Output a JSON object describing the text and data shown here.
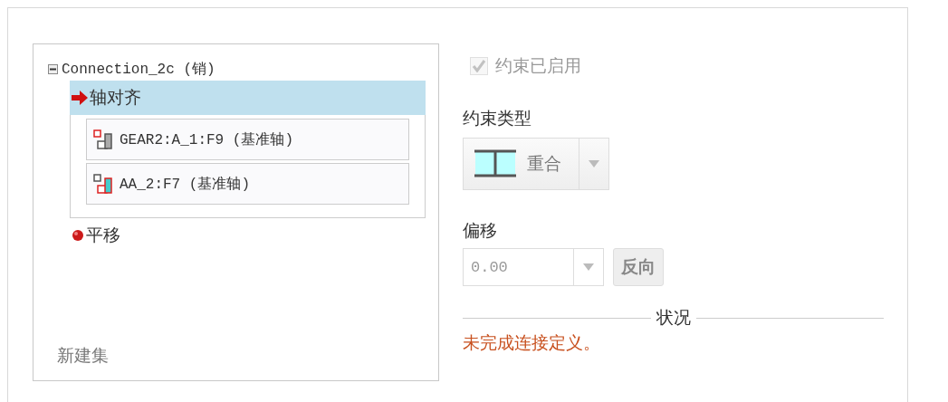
{
  "connection": {
    "name": "Connection_2c (销)",
    "expanded": true,
    "children": [
      {
        "name": "轴对齐",
        "kind": "arrow",
        "selected": true,
        "children": [
          {
            "label": "GEAR2:A_1:F9 (基准轴)",
            "kind": "first"
          },
          {
            "label": "AA_2:F7 (基准轴)",
            "kind": "second"
          }
        ]
      },
      {
        "name": "平移",
        "kind": "dot",
        "selected": false
      }
    ]
  },
  "new_set": "新建集",
  "enabled": {
    "label": "约束已启用",
    "checked": true,
    "disabled": true
  },
  "constraint_type": {
    "label": "约束类型",
    "value": "重合"
  },
  "offset": {
    "label": "偏移",
    "value": "0.00",
    "flip": "反向"
  },
  "status": {
    "title": "状况",
    "message": "未完成连接定义。"
  }
}
